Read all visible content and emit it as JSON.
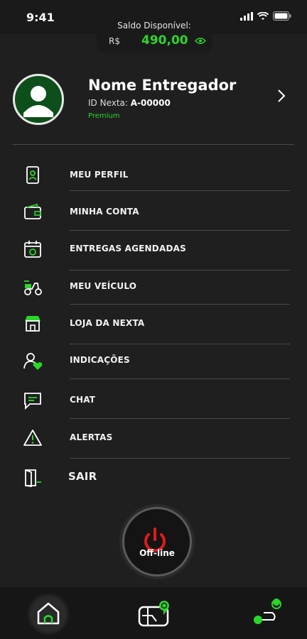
{
  "status": {
    "time": "9:41"
  },
  "balance": {
    "label": "Saldo Disponível:",
    "currency": "R$",
    "amount": "490,00"
  },
  "profile": {
    "name": "Nome Entregador",
    "id_label": "ID Nexta:",
    "id_value": "A-00000",
    "plan": "Premium"
  },
  "menu": {
    "profile": "MEU PERFIL",
    "account": "MINHA CONTA",
    "scheduled": "ENTREGAS AGENDADAS",
    "vehicle": "MEU VEÍCULO",
    "store": "LOJA DA NEXTA",
    "referrals": "INDICAÇÕES",
    "chat": "CHAT",
    "alerts": "ALERTAS",
    "logout": "SAIR"
  },
  "power": {
    "status": "Off-line"
  },
  "colors": {
    "accent": "#2bd62b",
    "power_red": "#e01b1b",
    "background": "#1f1f1f"
  }
}
